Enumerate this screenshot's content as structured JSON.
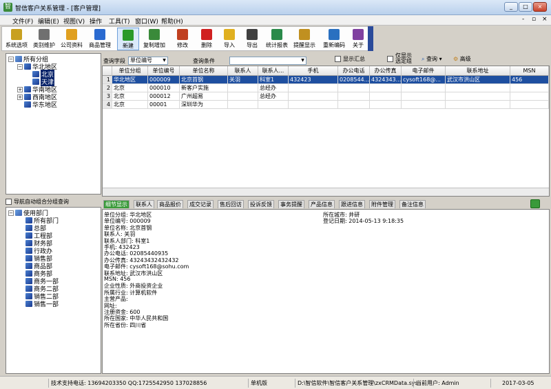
{
  "window": {
    "title": "智信客户关系管理 - [客户管理]",
    "buttons": [
      "_",
      "□",
      "×"
    ]
  },
  "menu": {
    "items": [
      "文件(F)",
      "编辑(E)",
      "视图(V)",
      "操作",
      "工具(T)",
      "窗口(W)",
      "帮助(H)"
    ],
    "right_controls": [
      "-",
      "▫",
      "×"
    ]
  },
  "toolbar": [
    {
      "label": "系统选项",
      "color": "#c8a020"
    },
    {
      "label": "类别维护",
      "color": "#707070"
    },
    {
      "label": "公司资料",
      "color": "#e0a020"
    },
    {
      "label": "商品管理",
      "color": "#2a6ad0"
    },
    {
      "label": "新建",
      "color": "#2a9a2a"
    },
    {
      "label": "复制增加",
      "color": "#3a8a3a"
    },
    {
      "label": "修改",
      "color": "#c04020"
    },
    {
      "label": "删除",
      "color": "#d02020"
    },
    {
      "label": "导入",
      "color": "#e0b020"
    },
    {
      "label": "导出",
      "color": "#404040"
    },
    {
      "label": "统计报表",
      "color": "#2a8a4a"
    },
    {
      "label": "提醒显示",
      "color": "#c09020"
    },
    {
      "label": "重新编码",
      "color": "#2a70c0"
    },
    {
      "label": "关于",
      "color": "#8040a0"
    }
  ],
  "tree_top": {
    "root": "所有分组",
    "nodes": [
      "华北地区",
      "北京",
      "天津",
      "华南地区",
      "西南地区",
      "华东地区"
    ]
  },
  "auto_query_label": "导航自动组合分组查询",
  "tree_bottom": {
    "root": "使用部门",
    "nodes": [
      "所有部门",
      "总部",
      "工程部",
      "财务部",
      "行政办",
      "销售部",
      "商品部",
      "商务部",
      "商务一部",
      "商务二部",
      "销售二部",
      "销售一部"
    ]
  },
  "query": {
    "field_label": "查询字段",
    "field_value": "单位编号",
    "cond_label": "查询条件",
    "cond_value": "",
    "show_summary": "显示汇总",
    "only_selected": "仅显示\n选定组",
    "query_btn": "查询",
    "advanced_btn": "高级"
  },
  "grid": {
    "columns": [
      "单位分组",
      "单位编号",
      "单位名称",
      "联系人",
      "联系人...",
      "手机",
      "办公电话",
      "办公传真",
      "电子邮件",
      "联系地址",
      "MSN"
    ],
    "rows": [
      {
        "n": "1",
        "cells": [
          "华北地区",
          "000009",
          "北京首钢",
          "关羽",
          "科室1",
          "432423",
          "0208544...",
          "4324343...",
          "cysoft168@...",
          "武汉市洪山区",
          "456"
        ]
      },
      {
        "n": "2",
        "cells": [
          "北京",
          "000010",
          "新客户实施",
          "",
          "总经办",
          "",
          "",
          "",
          "",
          "",
          ""
        ]
      },
      {
        "n": "3",
        "cells": [
          "北京",
          "000012",
          "广州超易",
          "",
          "总经办",
          "",
          "",
          "",
          "",
          "",
          ""
        ]
      },
      {
        "n": "4",
        "cells": [
          "北京",
          "00001",
          "深圳华为",
          "",
          "",
          "",
          "",
          "",
          "",
          "",
          ""
        ]
      }
    ]
  },
  "tabs": [
    "细节显示",
    "联系人",
    "商品报价",
    "成交记录",
    "售后回访",
    "投诉反馈",
    "事务提醒",
    "产品信息",
    "跟进信息",
    "附件管理",
    "备注信息"
  ],
  "detail": {
    "left": [
      "单位分组: 华北地区",
      "单位编号: 000009",
      "单位名称: 北京首钢",
      "联系人: 关羽",
      "联系人部门: 科室1",
      "手机: 432423",
      "办公电话: 02085440935",
      "办公传真: 43243432432432",
      "电子邮件: cysoft168@sohu.com",
      "联系地址: 武汉市洪山区",
      "MSN: 456",
      "企业性质: 外商投资企业",
      "所属行业: 计算机软件",
      "主营产品:",
      "网址:",
      "注册资金: 600",
      "所在国家: 中华人民共和国",
      "所在省份: 四川省"
    ],
    "right": [
      "所在城市: 井研",
      "登记日期: 2014-05-13 9:18:35"
    ]
  },
  "status": {
    "support": "技术支持电话: 13694203350 QQ:1725542950 137028856",
    "mode": "单机版",
    "path": "D:\\智信软件\\智信客户关系管理\\zxCRMData.sys",
    "user": "当前用户: Admin",
    "date": "2017-03-05"
  }
}
